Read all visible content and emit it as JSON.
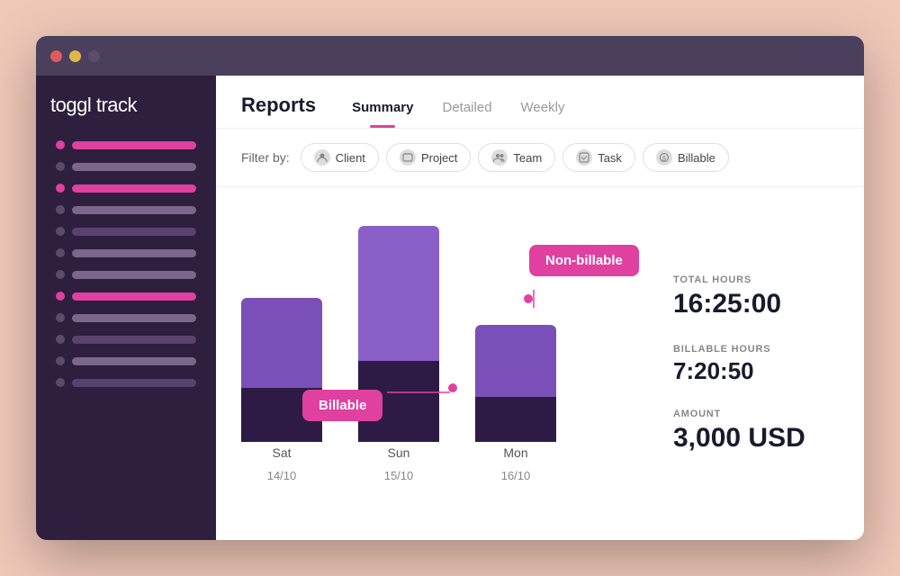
{
  "window": {
    "titlebar": {
      "lights": [
        "red",
        "yellow",
        "gray"
      ]
    }
  },
  "sidebar": {
    "logo": {
      "brand": "toggl",
      "product": " track"
    },
    "items": [
      {
        "id": 1,
        "color": "pink",
        "bar_color": "pink",
        "bar_width": "60%"
      },
      {
        "id": 2,
        "color": "gray",
        "bar_color": "light",
        "bar_width": "80%"
      },
      {
        "id": 3,
        "color": "pink",
        "bar_color": "pink",
        "bar_width": "45%"
      },
      {
        "id": 4,
        "color": "gray",
        "bar_color": "light",
        "bar_width": "75%"
      },
      {
        "id": 5,
        "color": "gray",
        "bar_color": "light",
        "bar_width": "65%"
      },
      {
        "id": 6,
        "color": "gray",
        "bar_color": "medium",
        "bar_width": "55%"
      },
      {
        "id": 7,
        "color": "gray",
        "bar_color": "light",
        "bar_width": "70%"
      },
      {
        "id": 8,
        "color": "pink",
        "bar_color": "pink",
        "bar_width": "50%"
      },
      {
        "id": 9,
        "color": "gray",
        "bar_color": "light",
        "bar_width": "60%"
      },
      {
        "id": 10,
        "color": "gray",
        "bar_color": "medium",
        "bar_width": "40%"
      },
      {
        "id": 11,
        "color": "gray",
        "bar_color": "light",
        "bar_width": "65%"
      },
      {
        "id": 12,
        "color": "gray",
        "bar_color": "light",
        "bar_width": "55%"
      },
      {
        "id": 13,
        "color": "gray",
        "bar_color": "medium",
        "bar_width": "45%"
      },
      {
        "id": 14,
        "color": "gray",
        "bar_color": "light",
        "bar_width": "70%"
      }
    ]
  },
  "header": {
    "reports_title": "Reports",
    "tabs": [
      {
        "id": "summary",
        "label": "Summary",
        "active": true
      },
      {
        "id": "detailed",
        "label": "Detailed",
        "active": false
      },
      {
        "id": "weekly",
        "label": "Weekly",
        "active": false
      }
    ]
  },
  "filter_bar": {
    "label": "Filter by:",
    "chips": [
      {
        "id": "client",
        "label": "Client",
        "icon": "👤"
      },
      {
        "id": "project",
        "label": "Project",
        "icon": "📁"
      },
      {
        "id": "team",
        "label": "Team",
        "icon": "👥"
      },
      {
        "id": "task",
        "label": "Task",
        "icon": "✓"
      },
      {
        "id": "billable",
        "label": "Billable",
        "icon": "$"
      }
    ]
  },
  "chart": {
    "bars": [
      {
        "day": "Sat",
        "date": "14/10",
        "total_height": 160,
        "billable_height": 60,
        "non_billable_height": 100,
        "color_top": "#6b3fa0",
        "color_bottom": "#2d1f3d"
      },
      {
        "day": "Sun",
        "date": "15/10",
        "total_height": 240,
        "billable_height": 90,
        "non_billable_height": 150,
        "color_top": "#7b4fb0",
        "color_bottom": "#2d1f3d"
      },
      {
        "day": "Mon",
        "date": "16/10",
        "total_height": 130,
        "billable_height": 50,
        "non_billable_height": 80,
        "color_top": "#6b3fa0",
        "color_bottom": "#2d1f3d"
      }
    ],
    "tooltips": {
      "non_billable": "Non-billable",
      "billable": "Billable"
    }
  },
  "stats": {
    "total_hours_label": "TOTAL HOURS",
    "total_hours_value": "16:25:00",
    "billable_hours_label": "BILLABLE HOURS",
    "billable_hours_value": "7:20:50",
    "amount_label": "AMOUNT",
    "amount_value": "3,000 USD"
  }
}
